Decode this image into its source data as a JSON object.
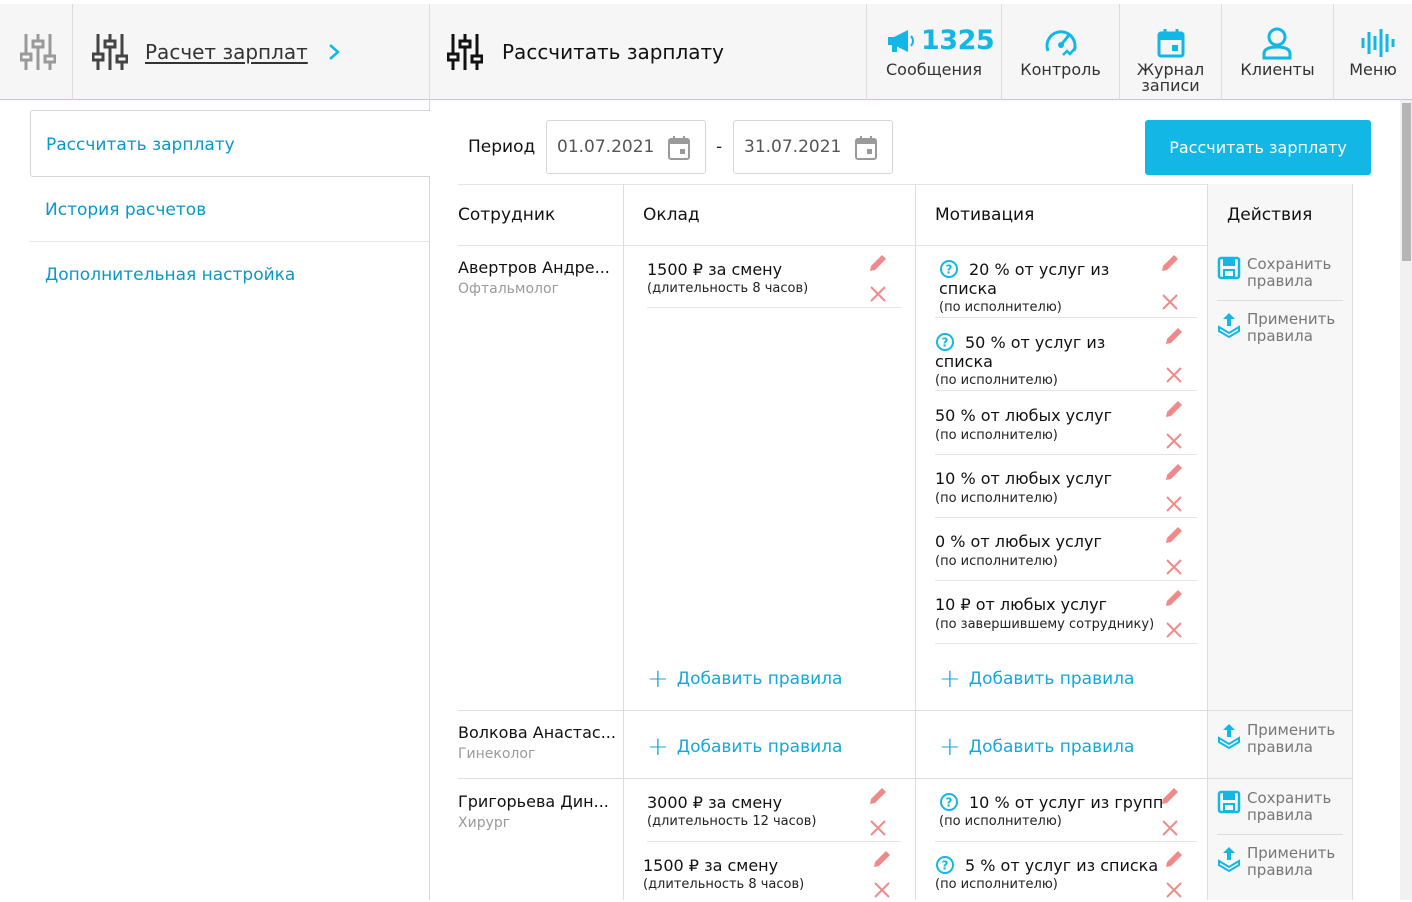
{
  "header": {
    "breadcrumb_label": "Расчет зарплат",
    "page_title": "Рассчитать зарплату",
    "messages_count": "1325",
    "nav": [
      {
        "label": "Сообщения",
        "icon": "megaphone-icon"
      },
      {
        "label": "Контроль",
        "icon": "speedometer-icon"
      },
      {
        "label": "Журнал записи",
        "icon": "calendar-icon"
      },
      {
        "label": "Клиенты",
        "icon": "user-icon"
      },
      {
        "label": "Меню",
        "icon": "menu-icon"
      }
    ]
  },
  "sidebar": {
    "items": [
      {
        "label": "Рассчитать зарплату",
        "active": true
      },
      {
        "label": "История расчетов",
        "active": false
      },
      {
        "label": "Дополнительная настройка",
        "active": false
      }
    ]
  },
  "period": {
    "label": "Период",
    "from": "01.07.2021",
    "separator": "-",
    "to": "31.07.2021"
  },
  "calc_button": "Рассчитать зарплату",
  "table": {
    "columns": [
      "Сотрудник",
      "Оклад",
      "Мотивация",
      "Действия"
    ],
    "add_label": "Добавить правила",
    "save_label": "Сохранить правила",
    "apply_label": "Применить правила",
    "rows": [
      {
        "name": "Авертров Андре...",
        "role": "Офтальмолог",
        "salary": [
          {
            "main": "1500 ₽ за смену",
            "sub": "(длительность 8 часов)"
          }
        ],
        "motivation": [
          {
            "main": "20 % от услуг из",
            "main2": "списка",
            "sub": "(по исполнителю)",
            "help": true
          },
          {
            "main": "50 % от услуг из",
            "main2": "списка",
            "sub": "(по исполнителю)",
            "help": true
          },
          {
            "main": "50 % от любых услуг",
            "sub": "(по исполнителю)",
            "help": false
          },
          {
            "main": "10 % от любых услуг",
            "sub": "(по исполнителю)",
            "help": false
          },
          {
            "main": "0 % от любых услуг",
            "sub": "(по исполнителю)",
            "help": false
          },
          {
            "main": "10 ₽ от любых услуг",
            "sub": "(по завершившему сотруднику)",
            "help": false
          }
        ]
      },
      {
        "name": "Волкова Анастас...",
        "role": "Гинеколог",
        "salary": [],
        "motivation": []
      },
      {
        "name": "Григорьева Дин...",
        "role": "Хирург",
        "salary": [
          {
            "main": "3000 ₽ за смену",
            "sub": "(длительность 12 часов)"
          },
          {
            "main": "1500 ₽ за смену",
            "sub": "(длительность 8 часов)"
          }
        ],
        "motivation": [
          {
            "main": "10 % от услуг из групп",
            "sub": "(по исполнителю)",
            "help": true
          },
          {
            "main": "5 % от услуг из списка",
            "sub": "(по исполнителю)",
            "help": true
          }
        ]
      }
    ]
  },
  "colors": {
    "accent": "#12b7e6",
    "link": "#0a98c8",
    "edit_icon": "#f08a8a",
    "delete_icon": "#f08a8a"
  }
}
